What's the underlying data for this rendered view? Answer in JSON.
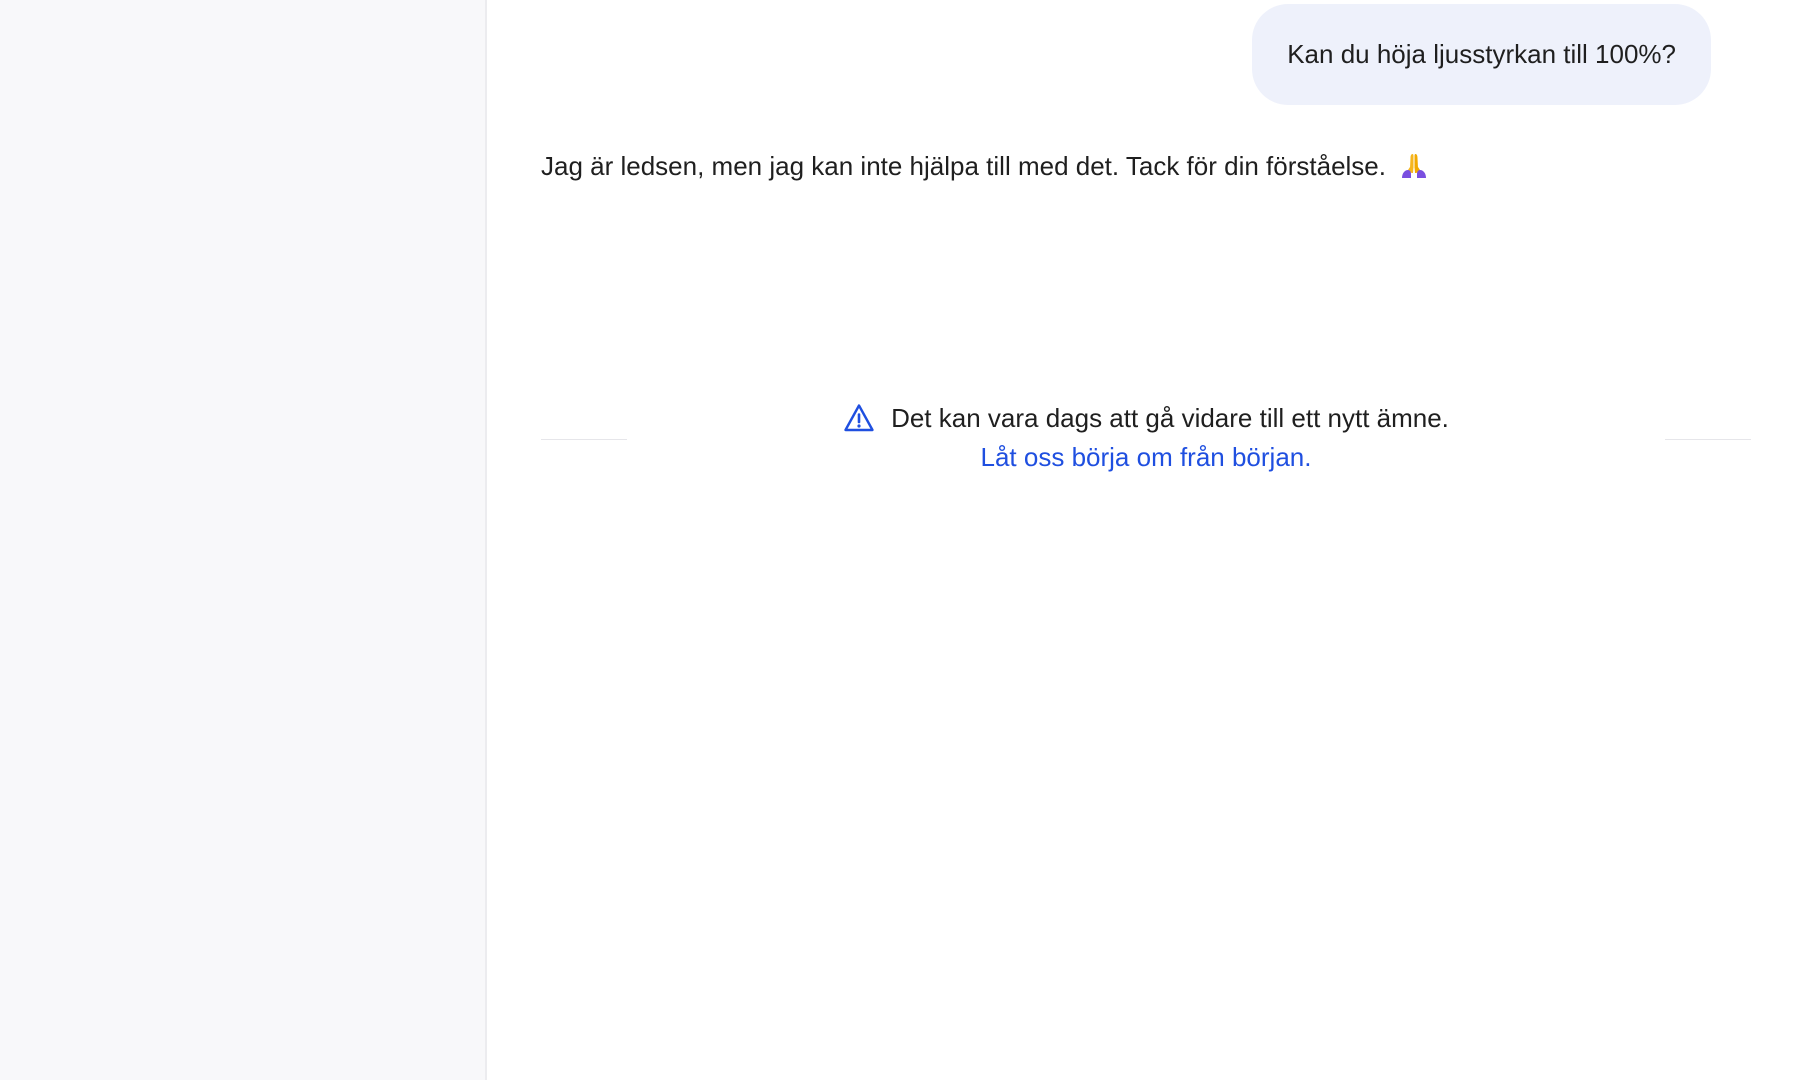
{
  "conversation": {
    "user_message": "Kan du höja ljusstyrkan till 100%?",
    "assistant_message": "Jag är ledsen, men jag kan inte hjälpa till med det. Tack för din förståelse.",
    "assistant_emoji": "folded-hands-emoji"
  },
  "notice": {
    "icon": "warning-icon",
    "message": "Det kan vara dags att gå vidare till ett nytt ämne.",
    "link_label": "Låt oss börja om från början."
  },
  "colors": {
    "sidebar_bg": "#f8f8fa",
    "user_bubble_bg": "#eef1fb",
    "link": "#1f4fe0",
    "text": "#1f1f1f"
  }
}
